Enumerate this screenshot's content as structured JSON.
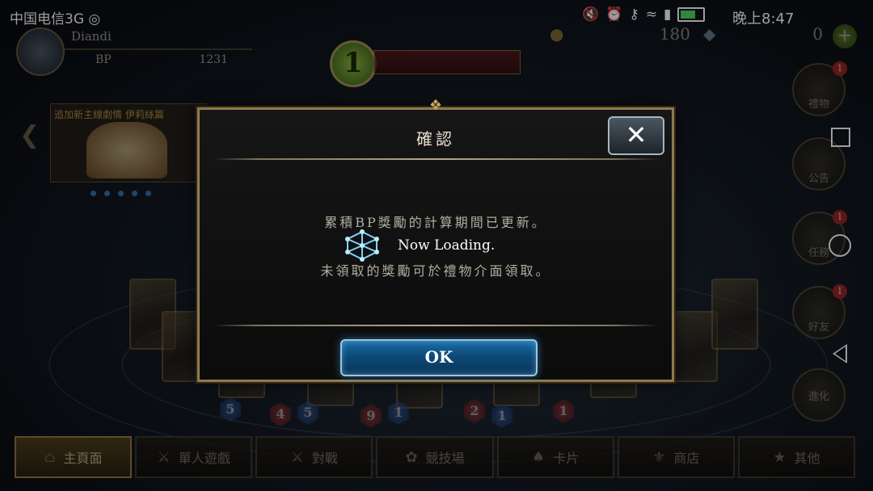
{
  "status_bar": {
    "carrier": "中国电信3G ◎ ",
    "time": "晚上8:47",
    "icons": [
      "mute-icon",
      "alarm-icon",
      "key-icon",
      "wifi-icon",
      "signal-icon",
      "battery-icon"
    ]
  },
  "player": {
    "name": "Diandi",
    "bp_label": "BP",
    "bp_value": "1231",
    "rank": "1"
  },
  "currency": {
    "rupies": "180",
    "crystals": "0",
    "plus": "+"
  },
  "news": {
    "text": "追加新主線劇情 伊莉絲篇"
  },
  "side_menu": [
    {
      "label": "禮物",
      "badge": "1"
    },
    {
      "label": "公告",
      "badge": ""
    },
    {
      "label": "任務",
      "badge": "1"
    },
    {
      "label": "好友",
      "badge": "1"
    },
    {
      "label": "進化",
      "badge": ""
    }
  ],
  "bottom_tabs": [
    {
      "label": "主頁面",
      "icon": "home-icon"
    },
    {
      "label": "單人遊戲",
      "icon": "sword-icon"
    },
    {
      "label": "對戰",
      "icon": "crossed-swords-icon"
    },
    {
      "label": "競技場",
      "icon": "laurel-icon"
    },
    {
      "label": "卡片",
      "icon": "cards-icon"
    },
    {
      "label": "商店",
      "icon": "shop-icon"
    },
    {
      "label": "其他",
      "icon": "misc-icon"
    }
  ],
  "dialog": {
    "title": "確認",
    "close": "✕",
    "message_line1": "累積BP獎勵的計算期間已更新。",
    "message_line2": "未領取的獎勵可於禮物介面領取。",
    "loading_text": "Now Loading.",
    "ok_label": "OK"
  },
  "colors": {
    "accent_gold": "#8f7a4d",
    "ok_blue": "#1b6fa8",
    "badge_red": "#c82828"
  }
}
